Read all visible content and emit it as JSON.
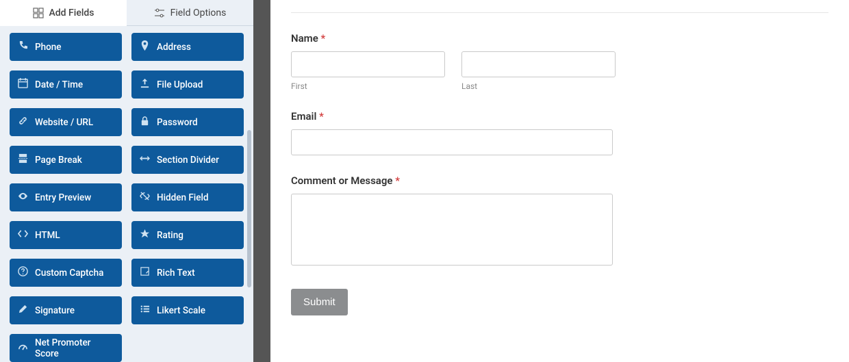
{
  "sidebar": {
    "tabs": {
      "add_fields": "Add Fields",
      "field_options": "Field Options"
    },
    "fields": [
      {
        "icon": "phone",
        "label": "Phone"
      },
      {
        "icon": "pin",
        "label": "Address"
      },
      {
        "icon": "calendar",
        "label": "Date / Time"
      },
      {
        "icon": "upload",
        "label": "File Upload"
      },
      {
        "icon": "link",
        "label": "Website / URL"
      },
      {
        "icon": "lock",
        "label": "Password"
      },
      {
        "icon": "pagebreak",
        "label": "Page Break"
      },
      {
        "icon": "divider",
        "label": "Section Divider"
      },
      {
        "icon": "eye",
        "label": "Entry Preview"
      },
      {
        "icon": "hidden",
        "label": "Hidden Field"
      },
      {
        "icon": "code",
        "label": "HTML"
      },
      {
        "icon": "star",
        "label": "Rating"
      },
      {
        "icon": "question",
        "label": "Custom Captcha"
      },
      {
        "icon": "richtext",
        "label": "Rich Text"
      },
      {
        "icon": "pen",
        "label": "Signature"
      },
      {
        "icon": "likert",
        "label": "Likert Scale"
      },
      {
        "icon": "gauge",
        "label": "Net Promoter Score"
      }
    ]
  },
  "form": {
    "name": {
      "label": "Name",
      "first_value": "",
      "first_sub": "First",
      "last_value": "",
      "last_sub": "Last"
    },
    "email": {
      "label": "Email",
      "value": ""
    },
    "comment": {
      "label": "Comment or Message",
      "value": ""
    },
    "submit_label": "Submit",
    "required_mark": "*"
  }
}
